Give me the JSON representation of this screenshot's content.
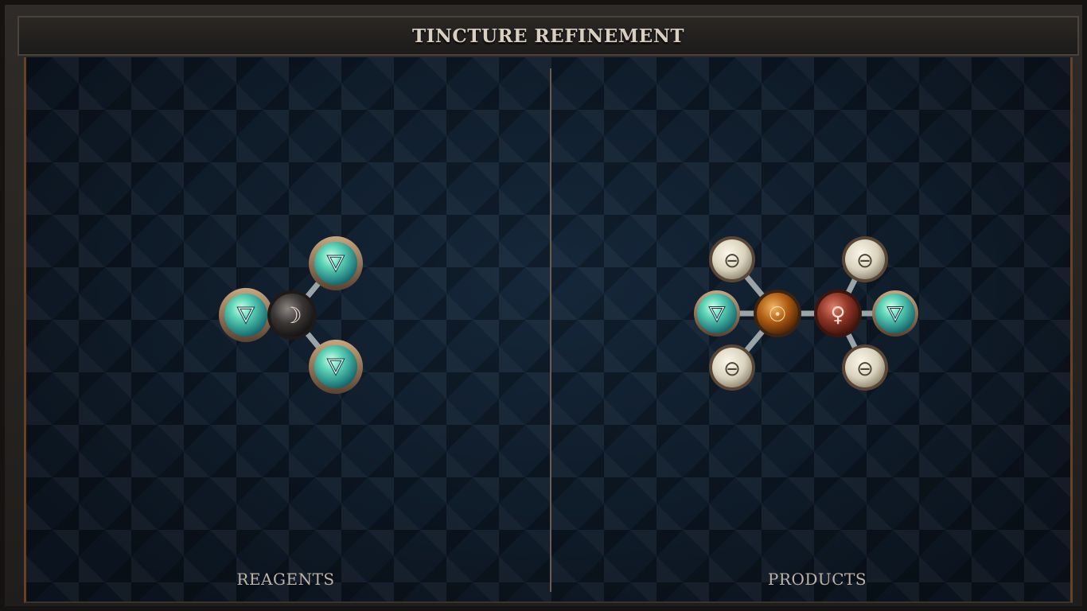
{
  "title": "TINCTURE REFINEMENT",
  "panels": {
    "reagents_label": "REAGENTS",
    "products_label": "PRODUCTS"
  },
  "reagent_molecule": {
    "atoms": [
      {
        "element": "silver",
        "symbol": "☽"
      },
      {
        "element": "water",
        "symbol": "🜄"
      },
      {
        "element": "water",
        "symbol": "🜄"
      },
      {
        "element": "water",
        "symbol": "🜄"
      }
    ]
  },
  "product_molecule": {
    "atoms": [
      {
        "element": "gold",
        "symbol": "☉"
      },
      {
        "element": "copper",
        "symbol": "♀"
      },
      {
        "element": "salt",
        "symbol": "⊖"
      },
      {
        "element": "salt",
        "symbol": "⊖"
      },
      {
        "element": "salt",
        "symbol": "⊖"
      },
      {
        "element": "salt",
        "symbol": "⊖"
      },
      {
        "element": "water",
        "symbol": "🜄"
      },
      {
        "element": "water",
        "symbol": "🜄"
      }
    ]
  },
  "colors": {
    "water": "#3fbfa8",
    "salt": "#d9d2bd",
    "gold": "#c06a1a",
    "copper": "#a0402e",
    "silver": "#3a3634",
    "frame_accent": "#6a4022"
  }
}
